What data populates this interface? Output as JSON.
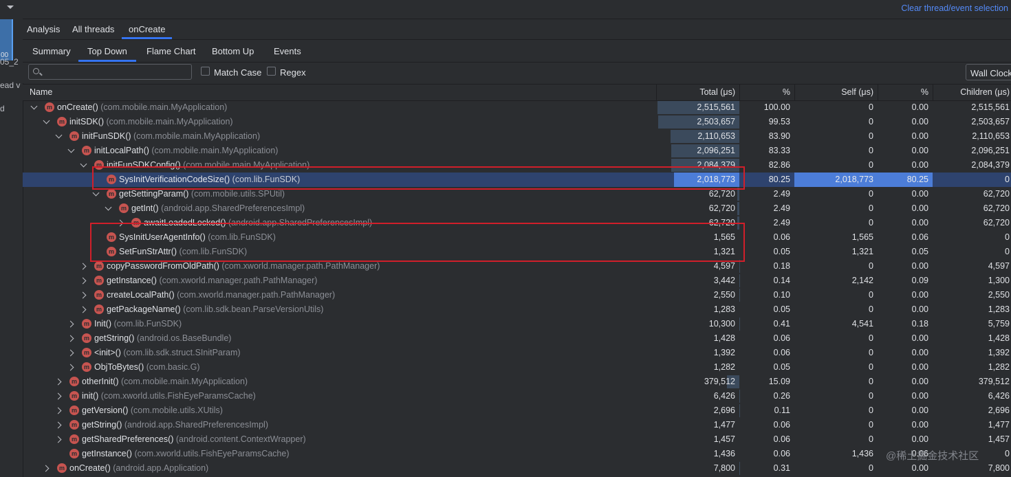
{
  "gutter": {
    "selected_label": "00",
    "fragments": [
      "05_2",
      "ead v",
      "d"
    ]
  },
  "header": {
    "clear_link": "Clear thread/event selection"
  },
  "tabs1": [
    "Analysis",
    "All threads",
    "onCreate"
  ],
  "tabs2": [
    "Summary",
    "Top Down",
    "Flame Chart",
    "Bottom Up",
    "Events"
  ],
  "search": {
    "placeholder": "",
    "match_case": "Match Case",
    "regex": "Regex",
    "clock": "Wall Clock"
  },
  "columns": {
    "name": "Name",
    "total": "Total (μs)",
    "pct": "%",
    "self": "Self (μs)",
    "self_pct": "%",
    "children": "Children (μs)"
  },
  "colors": {
    "accent": "#3574f0",
    "selected_row": "#2e436e",
    "method_icon": "#c75450",
    "highlight_box": "#d11f2a",
    "link": "#548af7"
  },
  "rows": [
    {
      "depth": 0,
      "exp": "exp",
      "method": "onCreate()",
      "pkg": "(com.mobile.main.MyApplication)",
      "total": "2,515,561",
      "pct": "100.00",
      "self": "0",
      "spct": "0.00",
      "children": "2,515,561",
      "frac": 1.0
    },
    {
      "depth": 1,
      "exp": "exp",
      "method": "initSDK()",
      "pkg": "(com.mobile.main.MyApplication)",
      "total": "2,503,657",
      "pct": "99.53",
      "self": "0",
      "spct": "0.00",
      "children": "2,503,657",
      "frac": 0.9953
    },
    {
      "depth": 2,
      "exp": "exp",
      "method": "initFunSDK()",
      "pkg": "(com.mobile.main.MyApplication)",
      "total": "2,110,653",
      "pct": "83.90",
      "self": "0",
      "spct": "0.00",
      "children": "2,110,653",
      "frac": 0.839
    },
    {
      "depth": 3,
      "exp": "exp",
      "method": "initLocalPath()",
      "pkg": "(com.mobile.main.MyApplication)",
      "total": "2,096,251",
      "pct": "83.33",
      "self": "0",
      "spct": "0.00",
      "children": "2,096,251",
      "frac": 0.8333
    },
    {
      "depth": 4,
      "exp": "exp",
      "method": "initFunSDKConfig()",
      "pkg": "(com.mobile.main.MyApplication)",
      "total": "2,084,379",
      "pct": "82.86",
      "self": "0",
      "spct": "0.00",
      "children": "2,084,379",
      "frac": 0.8286
    },
    {
      "depth": 5,
      "exp": "none",
      "method": "SysInitVerificationCodeSize()",
      "pkg": "(com.lib.FunSDK)",
      "total": "2,018,773",
      "pct": "80.25",
      "self": "2,018,773",
      "spct": "80.25",
      "children": "0",
      "frac": 0.8025,
      "selected": true
    },
    {
      "depth": 5,
      "exp": "exp",
      "method": "getSettingParam()",
      "pkg": "(com.mobile.utils.SPUtil)",
      "total": "62,720",
      "pct": "2.49",
      "self": "0",
      "spct": "0.00",
      "children": "62,720",
      "frac": 0.0249
    },
    {
      "depth": 6,
      "exp": "exp",
      "method": "getInt()",
      "pkg": "(android.app.SharedPreferencesImpl)",
      "total": "62,720",
      "pct": "2.49",
      "self": "0",
      "spct": "0.00",
      "children": "62,720",
      "frac": 0.0249
    },
    {
      "depth": 7,
      "exp": "col",
      "method": "awaitLoadedLocked()",
      "pkg": "(android.app.SharedPreferencesImpl)",
      "total": "62,720",
      "pct": "2.49",
      "self": "0",
      "spct": "0.00",
      "children": "62,720",
      "frac": 0.0249
    },
    {
      "depth": 5,
      "exp": "none",
      "method": "SysInitUserAgentInfo()",
      "pkg": "(com.lib.FunSDK)",
      "total": "1,565",
      "pct": "0.06",
      "self": "1,565",
      "spct": "0.06",
      "children": "0",
      "frac": 0.0006
    },
    {
      "depth": 5,
      "exp": "none",
      "method": "SetFunStrAttr()",
      "pkg": "(com.lib.FunSDK)",
      "total": "1,321",
      "pct": "0.05",
      "self": "1,321",
      "spct": "0.05",
      "children": "0",
      "frac": 0.0005
    },
    {
      "depth": 4,
      "exp": "col",
      "method": "copyPasswordFromOldPath()",
      "pkg": "(com.xworld.manager.path.PathManager)",
      "total": "4,597",
      "pct": "0.18",
      "self": "0",
      "spct": "0.00",
      "children": "4,597",
      "frac": 0.0018
    },
    {
      "depth": 4,
      "exp": "col",
      "method": "getInstance()",
      "pkg": "(com.xworld.manager.path.PathManager)",
      "total": "3,442",
      "pct": "0.14",
      "self": "2,142",
      "spct": "0.09",
      "children": "1,300",
      "frac": 0.0014
    },
    {
      "depth": 4,
      "exp": "col",
      "method": "createLocalPath()",
      "pkg": "(com.xworld.manager.path.PathManager)",
      "total": "2,550",
      "pct": "0.10",
      "self": "0",
      "spct": "0.00",
      "children": "2,550",
      "frac": 0.001
    },
    {
      "depth": 4,
      "exp": "col",
      "method": "getPackageName()",
      "pkg": "(com.lib.sdk.bean.ParseVersionUtils)",
      "total": "1,283",
      "pct": "0.05",
      "self": "0",
      "spct": "0.00",
      "children": "1,283",
      "frac": 0.0005
    },
    {
      "depth": 3,
      "exp": "col",
      "method": "Init()",
      "pkg": "(com.lib.FunSDK)",
      "total": "10,300",
      "pct": "0.41",
      "self": "4,541",
      "spct": "0.18",
      "children": "5,759",
      "frac": 0.0041
    },
    {
      "depth": 3,
      "exp": "col",
      "method": "getString()",
      "pkg": "(android.os.BaseBundle)",
      "total": "1,428",
      "pct": "0.06",
      "self": "0",
      "spct": "0.00",
      "children": "1,428",
      "frac": 0.0006
    },
    {
      "depth": 3,
      "exp": "col",
      "method": "<init>()",
      "pkg": "(com.lib.sdk.struct.SInitParam)",
      "total": "1,392",
      "pct": "0.06",
      "self": "0",
      "spct": "0.00",
      "children": "1,392",
      "frac": 0.0006
    },
    {
      "depth": 3,
      "exp": "col",
      "method": "ObjToBytes()",
      "pkg": "(com.basic.G)",
      "total": "1,282",
      "pct": "0.05",
      "self": "0",
      "spct": "0.00",
      "children": "1,282",
      "frac": 0.0005
    },
    {
      "depth": 2,
      "exp": "col",
      "method": "otherInit()",
      "pkg": "(com.mobile.main.MyApplication)",
      "total": "379,512",
      "pct": "15.09",
      "self": "0",
      "spct": "0.00",
      "children": "379,512",
      "frac": 0.1509
    },
    {
      "depth": 2,
      "exp": "col",
      "method": "init()",
      "pkg": "(com.xworld.utils.FishEyeParamsCache)",
      "total": "6,426",
      "pct": "0.26",
      "self": "0",
      "spct": "0.00",
      "children": "6,426",
      "frac": 0.0026
    },
    {
      "depth": 2,
      "exp": "col",
      "method": "getVersion()",
      "pkg": "(com.mobile.utils.XUtils)",
      "total": "2,696",
      "pct": "0.11",
      "self": "0",
      "spct": "0.00",
      "children": "2,696",
      "frac": 0.0011
    },
    {
      "depth": 2,
      "exp": "col",
      "method": "getString()",
      "pkg": "(android.app.SharedPreferencesImpl)",
      "total": "1,477",
      "pct": "0.06",
      "self": "0",
      "spct": "0.00",
      "children": "1,477",
      "frac": 0.0006
    },
    {
      "depth": 2,
      "exp": "col",
      "method": "getSharedPreferences()",
      "pkg": "(android.content.ContextWrapper)",
      "total": "1,457",
      "pct": "0.06",
      "self": "0",
      "spct": "0.00",
      "children": "1,457",
      "frac": 0.0006
    },
    {
      "depth": 2,
      "exp": "none",
      "method": "getInstance()",
      "pkg": "(com.xworld.utils.FishEyeParamsCache)",
      "total": "1,436",
      "pct": "0.06",
      "self": "1,436",
      "spct": "0.06",
      "children": "0",
      "frac": 0.0006
    },
    {
      "depth": 1,
      "exp": "col",
      "method": "onCreate()",
      "pkg": "(android.app.Application)",
      "total": "7,800",
      "pct": "0.31",
      "self": "0",
      "spct": "0.00",
      "children": "7,800",
      "frac": 0.0031
    }
  ],
  "watermark": "@稀土掘金技术社区"
}
